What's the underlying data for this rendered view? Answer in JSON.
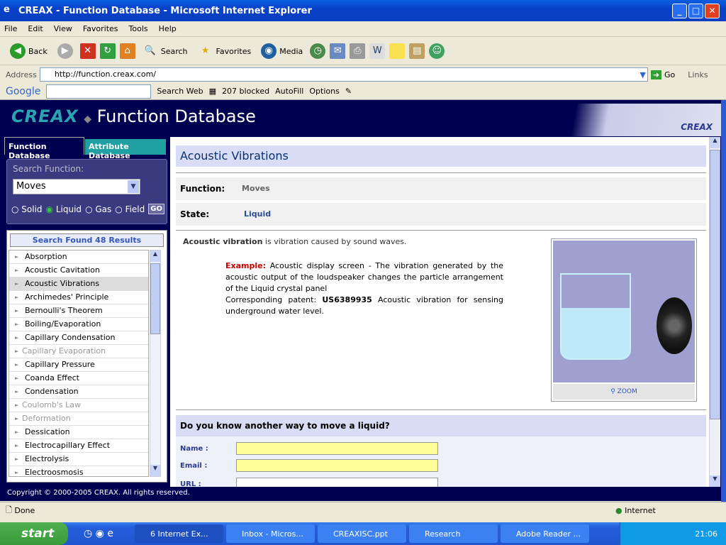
{
  "window": {
    "title": "CREAX - Function Database - Microsoft Internet Explorer",
    "minimize": "_",
    "maximize": "□",
    "close": "✕"
  },
  "menu": [
    "File",
    "Edit",
    "View",
    "Favorites",
    "Tools",
    "Help"
  ],
  "toolbar": {
    "back": "Back",
    "search": "Search",
    "favorites": "Favorites",
    "media": "Media"
  },
  "address": {
    "label": "Address",
    "url": "http://function.creax.com/",
    "go": "Go",
    "links": "Links"
  },
  "googlebar": {
    "logo": "Google",
    "search_web": "Search Web",
    "blocked": "207 blocked",
    "autofill": "AutoFill",
    "options": "Options"
  },
  "site": {
    "logo": "CREAX",
    "title": "Function Database",
    "brand": "CREAX"
  },
  "tabs": {
    "function_db": "Function Database",
    "attribute_db": "Attribute Database"
  },
  "search": {
    "label": "Search Function:",
    "value": "Moves",
    "states": [
      "Solid",
      "Liquid",
      "Gas",
      "Field"
    ],
    "selected_state": "Liquid",
    "go": "GO"
  },
  "results": {
    "header": "Search Found 48 Results",
    "items": [
      {
        "label": "Absorption",
        "disabled": false
      },
      {
        "label": "Acoustic Cavitation",
        "disabled": false
      },
      {
        "label": "Acoustic Vibrations",
        "disabled": false,
        "selected": true
      },
      {
        "label": "Archimedes' Principle",
        "disabled": false
      },
      {
        "label": "Bernoulli's Theorem",
        "disabled": false
      },
      {
        "label": "Boiling/Evaporation",
        "disabled": false
      },
      {
        "label": "Capillary Condensation",
        "disabled": false
      },
      {
        "label": "Capillary Evaporation",
        "disabled": true
      },
      {
        "label": "Capillary Pressure",
        "disabled": false
      },
      {
        "label": "Coanda Effect",
        "disabled": false
      },
      {
        "label": "Condensation",
        "disabled": false
      },
      {
        "label": "Coulomb's Law",
        "disabled": true
      },
      {
        "label": "Deformation",
        "disabled": true
      },
      {
        "label": "Dessication",
        "disabled": false
      },
      {
        "label": "Electrocapillary Effect",
        "disabled": false
      },
      {
        "label": "Electrolysis",
        "disabled": false
      },
      {
        "label": "Electroosmosis",
        "disabled": false
      }
    ]
  },
  "detail": {
    "title": "Acoustic Vibrations",
    "function_label": "Function:",
    "function_value": "Moves",
    "state_label": "State:",
    "state_value": "Liquid",
    "desc_bold": "Acoustic vibration",
    "desc_rest": " is vibration caused by sound waves.",
    "example_label": "Example:",
    "example_text": " Acoustic display screen - The vibration generated by the acoustic output of the loudspeaker changes the particle arrangement of the Liquid crystal panel",
    "patent_prefix": "Corresponding patent: ",
    "patent_number": "US6389935",
    "patent_text": " Acoustic vibration for sensing underground water level.",
    "zoom": "ZOOM"
  },
  "form": {
    "title": "Do you know another way to move a liquid?",
    "name_label": "Name :",
    "email_label": "Email :",
    "url_label": "URL :"
  },
  "footer": "Copyright © 2000-2005 CREAX. All rights reserved.",
  "status": {
    "text": "Done",
    "zone": "Internet"
  },
  "taskbar": {
    "start": "start",
    "tasks": [
      "6 Internet Ex...",
      "Inbox - Micros...",
      "CREAXISC.ppt",
      "Research",
      "Adobe Reader ..."
    ],
    "clock": "21:06"
  },
  "colors": {
    "navy": "#000050",
    "accent_title": "#0a3070",
    "example_red": "#cc0000",
    "tab_teal": "#20a0a0"
  }
}
